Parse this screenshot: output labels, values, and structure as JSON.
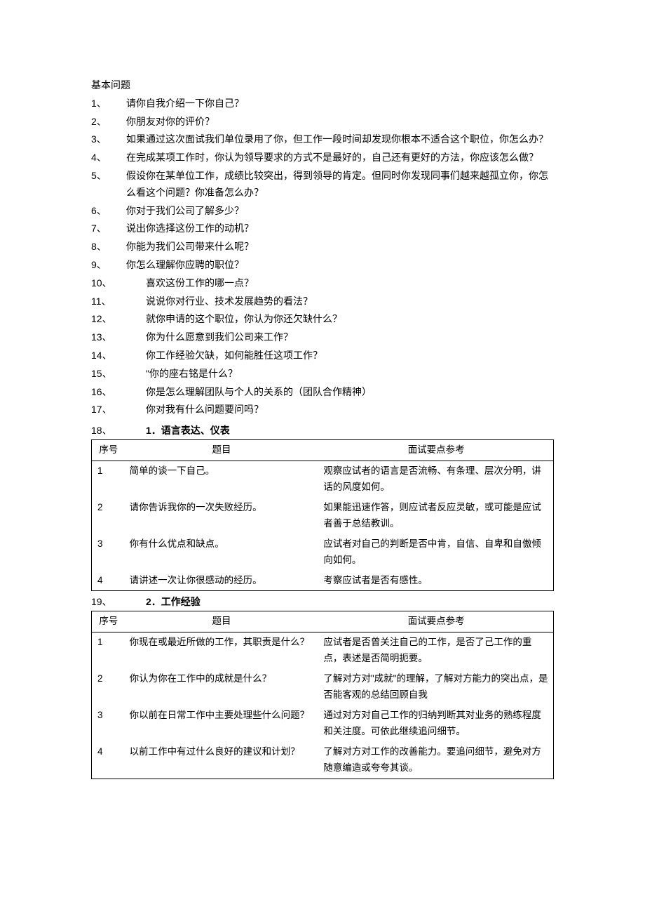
{
  "title": "基本问题",
  "questions": [
    {
      "num": "1、",
      "text": "请你自我介绍一下你自己？"
    },
    {
      "num": "2、",
      "text": "你朋友对你的评价？"
    },
    {
      "num": "3、",
      "text": "如果通过这次面试我们单位录用了你，但工作一段时间却发现你根本不适合这个职位，你怎么办？"
    },
    {
      "num": "4、",
      "text": "在完成某项工作时，你认为领导要求的方式不是最好的，自己还有更好的方法，你应该怎么做？"
    },
    {
      "num": "5、",
      "text": "假设你在某单位工作，成绩比较突出，得到领导的肯定。但同时你发现同事们越来越孤立你，你怎么看这个问题？你准备怎么办？"
    },
    {
      "num": "6、",
      "text": "你对于我们公司了解多少？"
    },
    {
      "num": "7、",
      "text": "说出你选择这份工作的动机？"
    },
    {
      "num": "8、",
      "text": "你能为我们公司带来什么呢？"
    },
    {
      "num": "9、",
      "text": "你怎么理解你应聘的职位？"
    },
    {
      "num": "10、",
      "text": "喜欢这份工作的哪一点？"
    },
    {
      "num": "11、",
      "text": "说说你对行业、技术发展趋势的看法？"
    },
    {
      "num": "12、",
      "text": "就你申请的这个职位，你认为你还欠缺什么？"
    },
    {
      "num": "13、",
      "text": "你为什么愿意到我们公司来工作？"
    },
    {
      "num": "14、",
      "text": "你工作经验欠缺，如何能胜任这项工作？"
    },
    {
      "num": "15、",
      "text": "\"你的座右铭是什么？"
    },
    {
      "num": "16、",
      "text": "你是怎么理解团队与个人的关系的（团队合作精神）"
    },
    {
      "num": "17、",
      "text": "你对我有什么问题要问吗？"
    }
  ],
  "section1": {
    "num": "18、",
    "title": "1．语言表达、仪表",
    "headers": {
      "col1": "序号",
      "col2": "题目",
      "col3": "面试要点参考"
    },
    "rows": [
      {
        "n": "1",
        "q": "简单的谈一下自己。",
        "p": "观察应试者的语言是否流畅、有条理、层次分明，讲话的风度如何。"
      },
      {
        "n": "2",
        "q": "请你告诉我你的一次失败经历。",
        "p": "如果能迅速作答，则应试者反应灵敏，或可能是应试者善于总结教训。"
      },
      {
        "n": "3",
        "q": "你有什么优点和缺点。",
        "p": "应试者对自己的判断是否中肯，自信、自卑和自傲倾向如何。"
      },
      {
        "n": "4",
        "q": "请讲述一次让你很感动的经历。",
        "p": "考察应试者是否有感性。"
      }
    ]
  },
  "section2": {
    "num": "19、",
    "title": "2．工作经验",
    "headers": {
      "col1": "序号",
      "col2": "题目",
      "col3": "面试要点参考"
    },
    "rows": [
      {
        "n": "1",
        "q": "你现在或最近所做的工作，其职责是什么？",
        "p": "应试者是否曾关注自己的工作，是否了己工作的重点，表述是否简明扼要。"
      },
      {
        "n": "2",
        "q": "你认为你在工作中的成就是什么？",
        "p": "了解对方对\"成就\"的理解，了解对方能力的突出点，是否能客观的总结回顾自我"
      },
      {
        "n": "3",
        "q": "你以前在日常工作中主要处理些什么问题？",
        "p": "通过对方对自己工作的归纳判断其对业务的熟练程度和关注度。可依此继续追问细节。"
      },
      {
        "n": "4",
        "q": "以前工作中有过什么良好的建议和计划？",
        "p": "了解对方对工作的改善能力。要追问细节，避免对方随意编造或夸夸其谈。"
      }
    ]
  }
}
